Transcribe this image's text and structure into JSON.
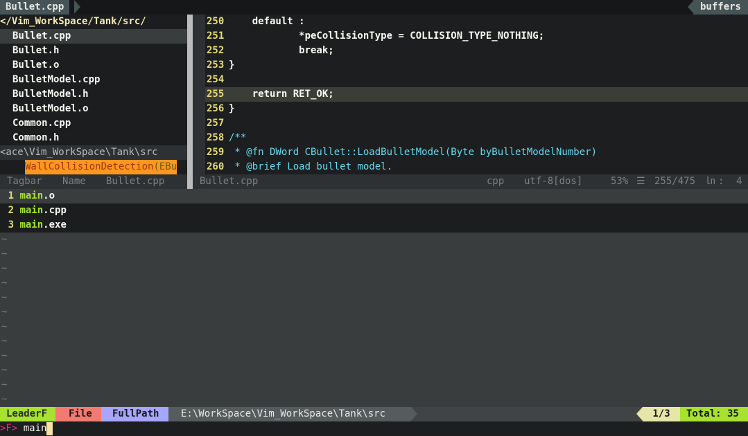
{
  "tabline": {
    "active_tab": "Bullet.cpp",
    "buffers_label": "buffers"
  },
  "tree": {
    "path": "</Vim_WorkSpace/Tank/src/",
    "items": [
      "Bullet.cpp",
      "Bullet.h",
      "Bullet.o",
      "BulletModel.cpp",
      "BulletModel.h",
      "BulletModel.o",
      "Common.cpp",
      "Common.h"
    ],
    "selected_index": 0,
    "status": "<ace\\Vim_WorkSpace\\Tank\\src"
  },
  "tagbar": {
    "tag_name": "WallCollisionDetection",
    "tag_paren": "(EBu",
    "status_tagbar": "Tagbar",
    "status_name": "Name",
    "status_file": "Bullet.cpp"
  },
  "code": {
    "lines": [
      {
        "num": "250",
        "text": "    default :"
      },
      {
        "num": "251",
        "text": "            *peCollisionType = COLLISION_TYPE_NOTHING;"
      },
      {
        "num": "252",
        "text": "            break;"
      },
      {
        "num": "253",
        "text": "}"
      },
      {
        "num": "254",
        "text": ""
      },
      {
        "num": "255",
        "text": "    return RET_OK;"
      },
      {
        "num": "256",
        "text": "}"
      },
      {
        "num": "257",
        "text": ""
      },
      {
        "num": "258",
        "text": "/**"
      },
      {
        "num": "259",
        "text": " * @fn DWord CBullet::LoadBulletModel(Byte byBulletModelNumber)"
      },
      {
        "num": "260",
        "text": " * @brief Load bullet model."
      }
    ]
  },
  "main_status": {
    "file": "Bullet.cpp",
    "filetype": "cpp",
    "encoding": "utf-8[dos]",
    "percent": "53%",
    "position": "255/475",
    "column": "4"
  },
  "filelist": {
    "query": "main",
    "items": [
      {
        "num": "1",
        "match": "main",
        "rest": ".o"
      },
      {
        "num": "2",
        "match": "main",
        "rest": ".cpp"
      },
      {
        "num": "3",
        "match": "main",
        "rest": ".exe"
      }
    ]
  },
  "tildes": [
    "~",
    "~",
    "~",
    "~",
    "~",
    "~",
    "~",
    "~",
    "~",
    "~",
    "~",
    "~"
  ],
  "statusline": {
    "leader": "LeaderF",
    "file": "File",
    "fullpath": "FullPath",
    "path": "E:\\WorkSpace\\Vim_WorkSpace\\Tank\\src",
    "count": "1/3",
    "total": "Total: 35"
  },
  "prompt": {
    "label": ">F>",
    "input": "main"
  }
}
